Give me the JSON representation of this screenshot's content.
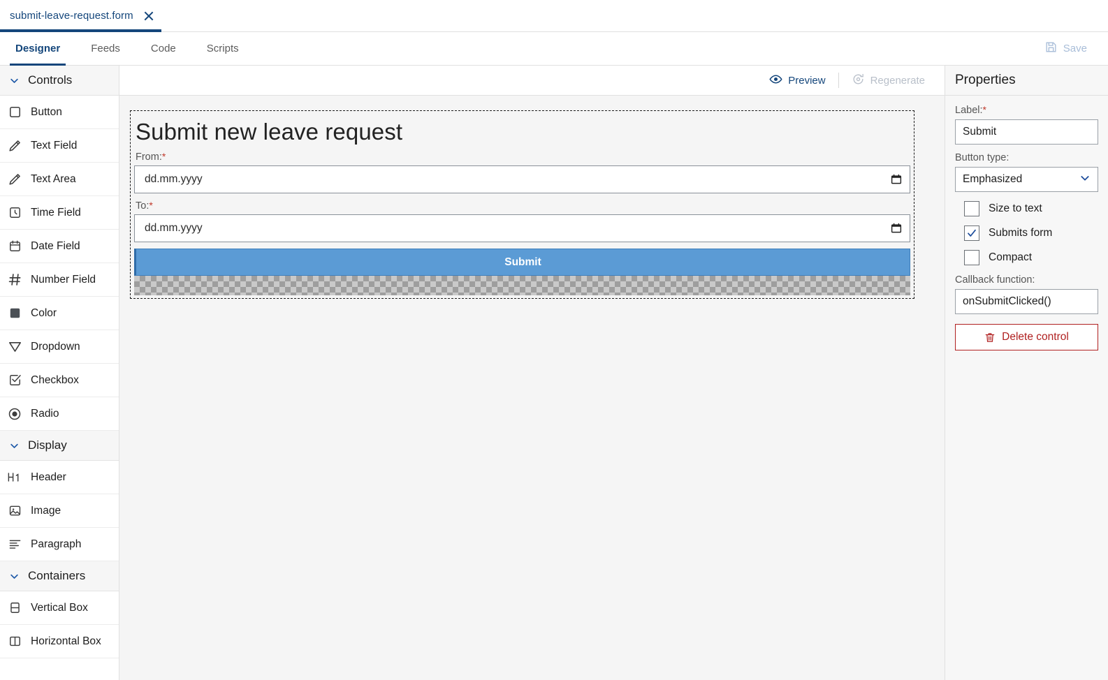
{
  "window": {
    "file_tab": {
      "label": "submit-leave-request.form",
      "close_icon": "close-icon"
    }
  },
  "navbar": {
    "tabs": [
      {
        "label": "Designer",
        "active": true
      },
      {
        "label": "Feeds",
        "active": false
      },
      {
        "label": "Code",
        "active": false
      },
      {
        "label": "Scripts",
        "active": false
      }
    ],
    "save": {
      "label": "Save",
      "icon": "save-disk-icon",
      "enabled": false,
      "color": "#a8bdd8"
    }
  },
  "palette": {
    "sections": [
      {
        "title": "Controls",
        "chevron_icon": "chevron-down-icon",
        "items": [
          {
            "label": "Button",
            "icon": "square-outline-icon"
          },
          {
            "label": "Text Field",
            "icon": "pencil-icon"
          },
          {
            "label": "Text Area",
            "icon": "pencil-icon"
          },
          {
            "label": "Time Field",
            "icon": "clock-icon"
          },
          {
            "label": "Date Field",
            "icon": "calendar-icon"
          },
          {
            "label": "Number Field",
            "icon": "hash-icon"
          },
          {
            "label": "Color",
            "icon": "filled-square-icon"
          },
          {
            "label": "Dropdown",
            "icon": "triangle-down-icon"
          },
          {
            "label": "Checkbox",
            "icon": "checkbox-icon"
          },
          {
            "label": "Radio",
            "icon": "radio-icon"
          }
        ]
      },
      {
        "title": "Display",
        "chevron_icon": "chevron-down-icon",
        "items": [
          {
            "label": "Header",
            "icon": "heading-h1-icon"
          },
          {
            "label": "Image",
            "icon": "image-icon"
          },
          {
            "label": "Paragraph",
            "icon": "paragraph-lines-icon"
          }
        ]
      },
      {
        "title": "Containers",
        "chevron_icon": "chevron-down-icon",
        "items": [
          {
            "label": "Vertical Box",
            "icon": "vertical-box-icon"
          },
          {
            "label": "Horizontal Box",
            "icon": "horizontal-box-icon"
          }
        ]
      }
    ]
  },
  "canvas": {
    "toolbar": {
      "preview": {
        "label": "Preview",
        "icon": "eye-icon",
        "enabled": true
      },
      "regenerate": {
        "label": "Regenerate",
        "icon": "refresh-gear-icon",
        "enabled": false
      }
    },
    "form": {
      "title": "Submit new leave request",
      "fields": [
        {
          "label": "From:",
          "required": true,
          "placeholder": "dd.mm.yyyy",
          "value": "",
          "icon": "calendar-picker-icon"
        },
        {
          "label": "To:",
          "required": true,
          "placeholder": "dd.mm.yyyy",
          "value": "",
          "icon": "calendar-picker-icon"
        }
      ],
      "submit_button": {
        "label": "Submit",
        "color": "#5b9bd5",
        "selected": true
      },
      "dropzone": {
        "name": "drop-target-placeholder"
      }
    }
  },
  "properties": {
    "title": "Properties",
    "label_field": {
      "label": "Label:",
      "required": true,
      "value": "Submit"
    },
    "button_type": {
      "label": "Button type:",
      "value": "Emphasized",
      "chevron_icon": "chevron-down-icon"
    },
    "checkboxes": [
      {
        "label": "Size to text",
        "checked": false
      },
      {
        "label": "Submits form",
        "checked": true
      },
      {
        "label": "Compact",
        "checked": false
      }
    ],
    "callback": {
      "label": "Callback function:",
      "value": "onSubmitClicked()"
    },
    "delete_button": {
      "label": "Delete control",
      "icon": "trash-icon",
      "color": "#b02020"
    }
  },
  "colors": {
    "accent": "#14467b",
    "button_blue": "#5b9bd5",
    "danger": "#b02020",
    "required_star": "#c0392b",
    "canvas_bg": "#f5f5f5"
  }
}
